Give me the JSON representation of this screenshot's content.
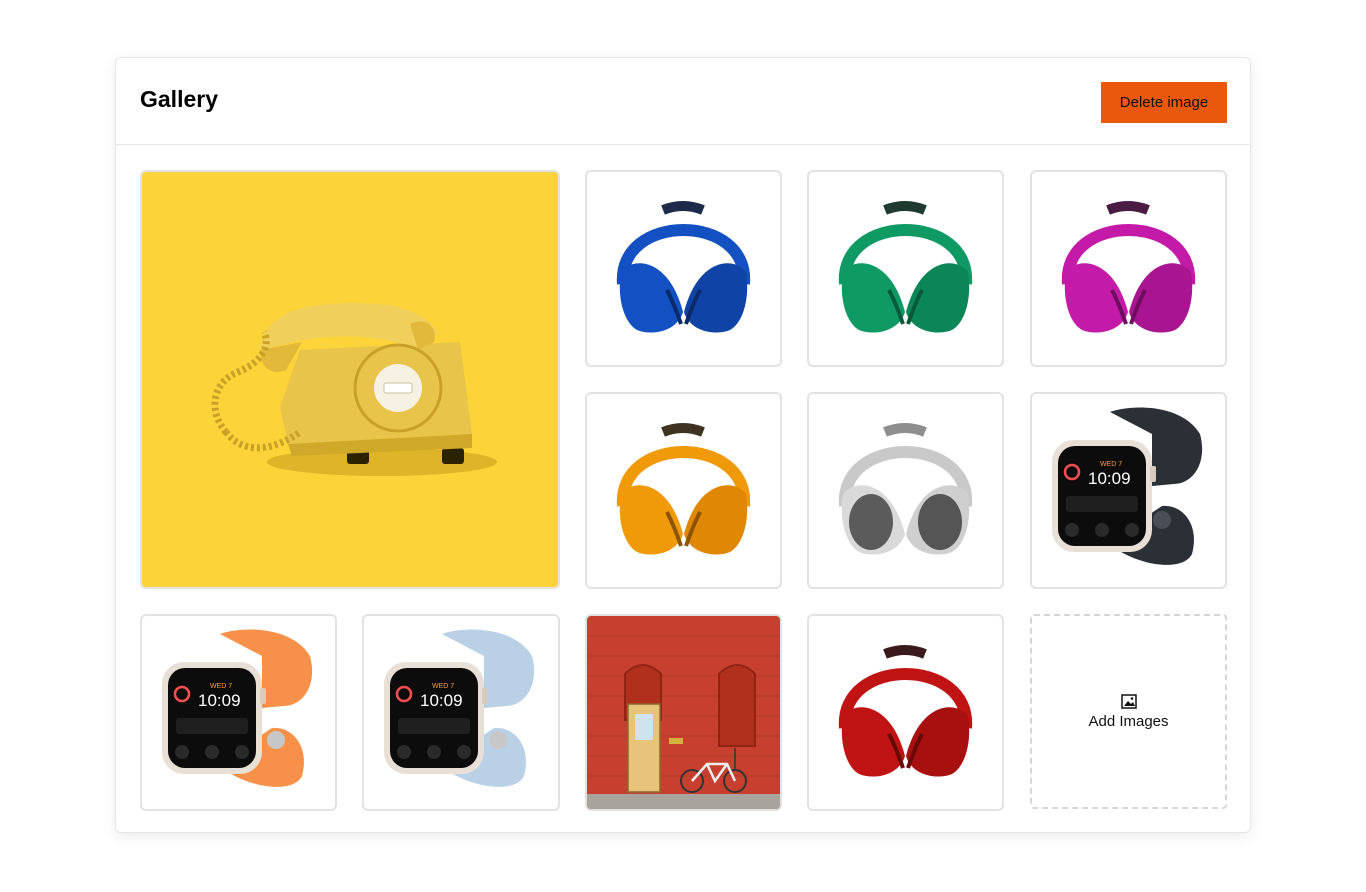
{
  "gallery": {
    "title": "Gallery",
    "delete_button_label": "Delete image",
    "add_images_label": "Add Images",
    "accent_color": "#ea580c",
    "images": [
      {
        "subject": "yellow rotary telephone",
        "background": "#fdd33a",
        "featured": true
      },
      {
        "subject": "blue headphones",
        "color": "#1351c2"
      },
      {
        "subject": "green headphones",
        "color": "#0e9a62"
      },
      {
        "subject": "magenta headphones",
        "color": "#c41aa8"
      },
      {
        "subject": "orange headphones",
        "color": "#f09a0a"
      },
      {
        "subject": "silver headphones",
        "color": "#c9c9c9"
      },
      {
        "subject": "smartwatch black band",
        "band_color": "#2b2f36",
        "watch_time": "10:09",
        "watch_date": "WED 7"
      },
      {
        "subject": "smartwatch orange band",
        "band_color": "#f7914a",
        "watch_time": "10:09",
        "watch_date": "WED 7"
      },
      {
        "subject": "smartwatch light blue band",
        "band_color": "#b9d0e6",
        "watch_time": "10:09",
        "watch_date": "WED 7"
      },
      {
        "subject": "red brick building with bicycle",
        "background": "#c7402f"
      },
      {
        "subject": "red headphones",
        "color": "#c01414"
      }
    ]
  }
}
